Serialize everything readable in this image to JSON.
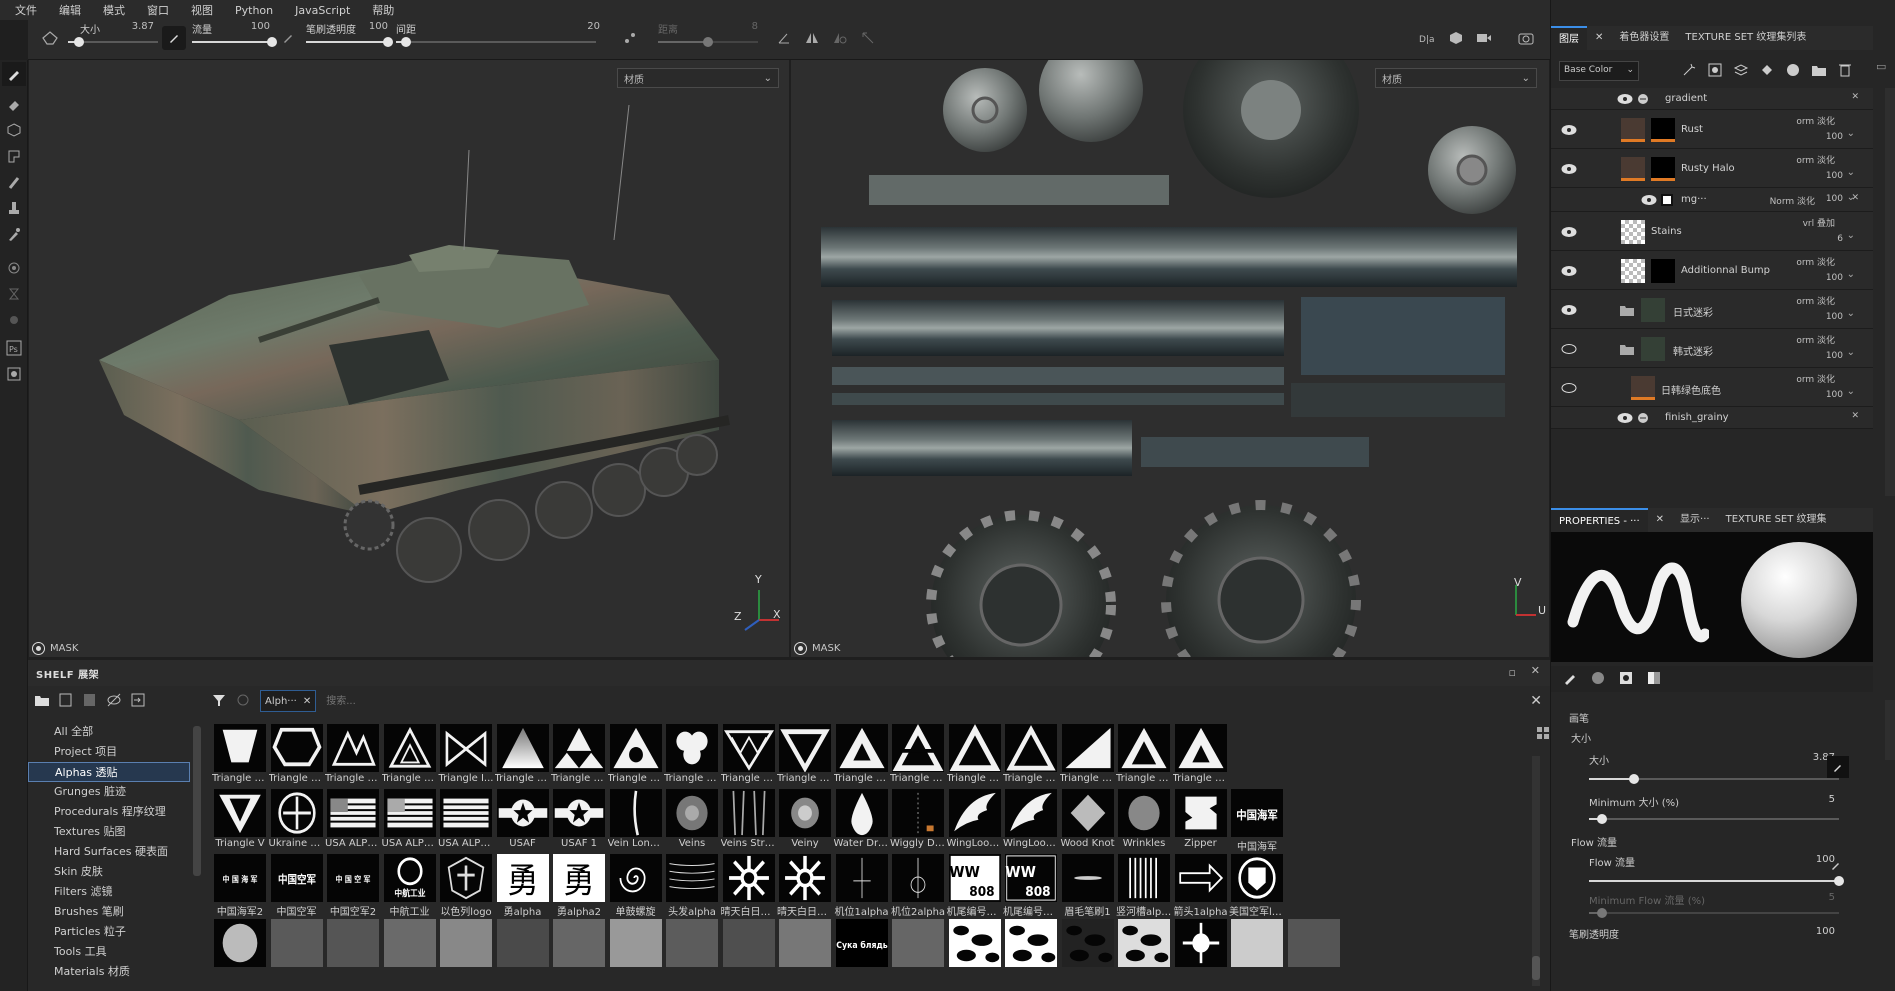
{
  "menubar": {
    "items": [
      "文件",
      "编辑",
      "模式",
      "窗口",
      "视图",
      "Python",
      "JavaScript",
      "帮助"
    ]
  },
  "toolbar": {
    "size_label": "大小",
    "size_value": "3.87",
    "size_fraction": 0.12,
    "flow_label": "流量",
    "flow_value": "100",
    "flow_fraction": 1.0,
    "stroke_opacity_label": "笔刷透明度",
    "stroke_opacity_value": "100",
    "stroke_opacity_fraction": 1.0,
    "spacing_label": "间距",
    "spacing_value": "20",
    "spacing_fraction": 0.05,
    "distance_label": "距离",
    "distance_value": "8",
    "distance_fraction": 0.5
  },
  "viewport3d": {
    "material_select": "材质",
    "mask_label": "MASK",
    "axis_x": "X",
    "axis_y": "Y",
    "axis_z": "Z"
  },
  "viewport2d": {
    "material_select": "材质",
    "mask_label": "MASK",
    "axis_u": "U",
    "axis_v": "V"
  },
  "shelf": {
    "title": "SHELF 展架",
    "filter_tag": "Alph···",
    "search_placeholder": "搜索...",
    "categories": [
      {
        "label": "All 全部",
        "selected": false
      },
      {
        "label": "Project 项目",
        "selected": false
      },
      {
        "label": "Alphas 透贴",
        "selected": true
      },
      {
        "label": "Grunges 脏迹",
        "selected": false
      },
      {
        "label": "Procedurals 程序纹理",
        "selected": false
      },
      {
        "label": "Textures 贴图",
        "selected": false
      },
      {
        "label": "Hard Surfaces 硬表面",
        "selected": false
      },
      {
        "label": "Skin 皮肤",
        "selected": false
      },
      {
        "label": "Filters 滤镜",
        "selected": false
      },
      {
        "label": "Brushes 笔刷",
        "selected": false
      },
      {
        "label": "Particles 粒子",
        "selected": false
      },
      {
        "label": "Tools 工具",
        "selected": false
      },
      {
        "label": "Materials 材质",
        "selected": false
      }
    ],
    "rows": [
      [
        "Triangle Cut",
        "Triangle C...",
        "Triangle D...",
        "Triangle D...",
        "Triangle I...",
        "Triangle Li...",
        "Triangle P...",
        "Triangle R...",
        "Triangle R...",
        "Triangle R...",
        "Triangle S...",
        "Triangle S...",
        "Triangle S...",
        "Triangle S...",
        "Triangle S...",
        "Triangle T...",
        "Triangle T...",
        "Triangle T..."
      ],
      [
        "Triangle V",
        "Ukraine ar...",
        "USA ALPH...",
        "USA ALPH...",
        "USA ALPH...",
        "USAF",
        "USAF 1",
        "Vein Long ...",
        "Veins",
        "Veins Stra...",
        "Veiny",
        "Water Drop",
        "Wiggly Dots",
        "WingLoon...",
        "WingLoon...",
        "Wood Knot",
        "Wrinkles",
        "Zipper",
        "中国海军"
      ],
      [
        "中国海军2",
        "中国空军",
        "中国空军2",
        "中航工业",
        "以色列logo",
        "勇alpha",
        "勇alpha2",
        "单鼓螺旋",
        "头发alpha",
        "晴天白日2 ...",
        "晴天白日2 ...",
        "机位1alpha",
        "机位2alpha",
        "机尾编号al...",
        "机尾编号al...",
        "眉毛笔刷1",
        "竖河槽alpha",
        "箭头1alpha",
        "美国空军lo..."
      ],
      [
        "",
        "",
        "",
        "",
        "",
        "",
        "",
        "",
        "",
        "",
        "",
        "",
        "",
        "",
        "",
        "",
        "",
        "",
        "",
        ""
      ]
    ],
    "thumb_texts": {
      "navy": "中国海军",
      "navy2": "中 国 海 军",
      "airforce": "中国空军",
      "airforce2": "中 国 空 军",
      "avic": "中航工业",
      "yong": "勇",
      "ww": "WW",
      "num808": "808",
      "suka": "Сука блядь"
    }
  },
  "layers": {
    "tabs": [
      "图层",
      "着色器设置",
      "TEXTURE SET 纹理集列表"
    ],
    "base_color": "Base Color",
    "items": [
      {
        "name": "gradient",
        "blend": "",
        "opacity": "",
        "kind": "sub",
        "visible": true
      },
      {
        "name": "Rust",
        "blend": "orm 淡化",
        "opacity": "100",
        "kind": "fill",
        "visible": true
      },
      {
        "name": "Rusty Halo",
        "blend": "orm 淡化",
        "opacity": "100",
        "kind": "fill",
        "visible": true
      },
      {
        "name": "mg···",
        "blend": "Norm 淡化",
        "opacity": "100",
        "kind": "mask",
        "visible": true
      },
      {
        "name": "Stains",
        "blend": "vrl 叠加",
        "opacity": "6",
        "kind": "checker",
        "visible": true
      },
      {
        "name": "Additionnal Bump",
        "blend": "orm 淡化",
        "opacity": "100",
        "kind": "checker",
        "visible": true
      },
      {
        "name": "日式迷彩",
        "blend": "orm 淡化",
        "opacity": "100",
        "kind": "folder",
        "visible": true
      },
      {
        "name": "韩式迷彩",
        "blend": "orm 淡化",
        "opacity": "100",
        "kind": "folder",
        "visible": false
      },
      {
        "name": "日韩绿色底色",
        "blend": "orm 淡化",
        "opacity": "100",
        "kind": "fill",
        "visible": false
      },
      {
        "name": "finish_grainy",
        "blend": "",
        "opacity": "",
        "kind": "sub",
        "visible": true
      }
    ]
  },
  "properties": {
    "tabs": [
      "PROPERTIES - ···",
      "显示···",
      "TEXTURE SET 纹理集"
    ],
    "section": "画笔",
    "size_group": "大小",
    "size_label": "大小",
    "size_value": "3.87",
    "size_fraction": 0.18,
    "min_size_label": "Minimum 大小 (%)",
    "min_size_value": "5",
    "min_size_fraction": 0.05,
    "flow_group": "Flow 流量",
    "flow_label": "Flow 流量",
    "flow_value": "100",
    "flow_fraction": 1.0,
    "min_flow_label": "Minimum Flow 流量 (%)",
    "min_flow_value": "5",
    "min_flow_fraction": 0.05,
    "stroke_opacity_label": "笔刷透明度",
    "stroke_opacity_value": "100"
  },
  "colors": {
    "accent": "#3b8ee8",
    "orange": "#e07a25",
    "panel": "#262626",
    "select": "#26384f"
  }
}
